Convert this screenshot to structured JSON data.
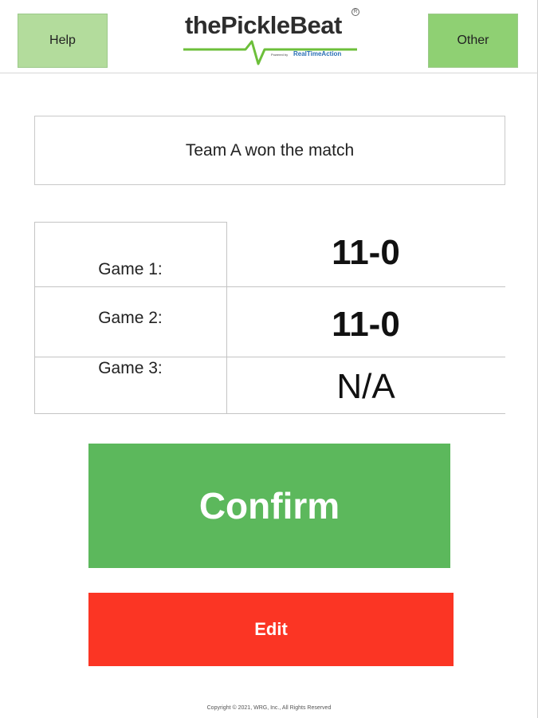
{
  "header": {
    "help_label": "Help",
    "other_label": "Other",
    "logo": {
      "text": "thePickleBeat",
      "registered": "R",
      "powered_by": "Powered by",
      "brand": "RealTimeAction"
    }
  },
  "result": {
    "text": "Team A won the match"
  },
  "games": [
    {
      "label": "Game 1:",
      "score": "11-0"
    },
    {
      "label": "Game 2:",
      "score": "11-0"
    },
    {
      "label": "Game 3:",
      "score": "N/A"
    }
  ],
  "actions": {
    "confirm_label": "Confirm",
    "edit_label": "Edit"
  },
  "footer": {
    "copyright": "Copyright © 2021, WRG, Inc., All Rights Reserved"
  },
  "colors": {
    "help_bg": "#b3dc9c",
    "other_bg": "#8fd073",
    "confirm_bg": "#5cb85c",
    "edit_bg": "#fb3524",
    "logo_green": "#6cbf3a",
    "brand_blue": "#2a6fb5"
  }
}
